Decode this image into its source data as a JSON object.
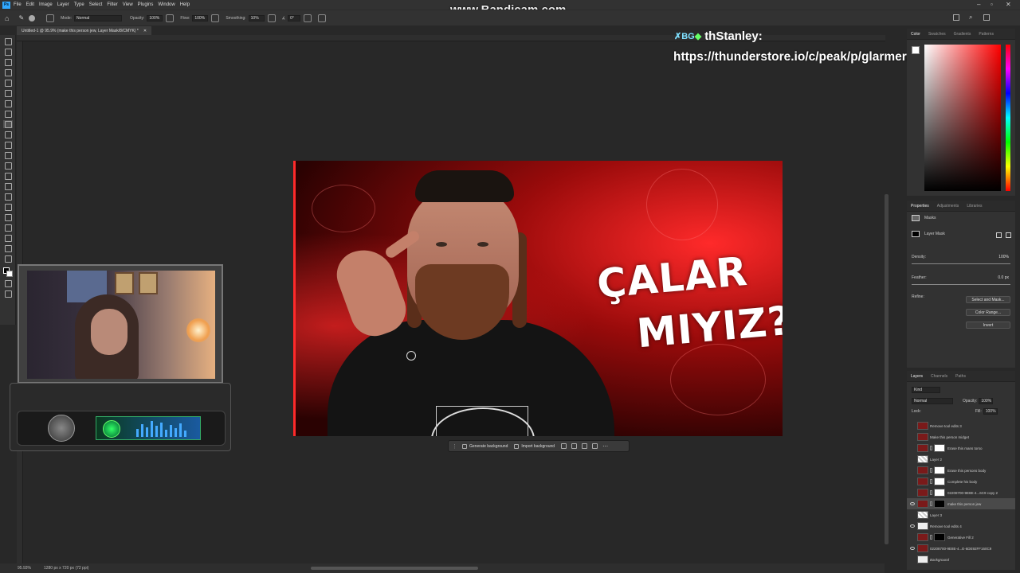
{
  "watermark": "www.Bandicam.com",
  "menu": [
    "File",
    "Edit",
    "Image",
    "Layer",
    "Type",
    "Select",
    "Filter",
    "View",
    "Plugins",
    "Window",
    "Help"
  ],
  "options": {
    "mode_label": "Mode:",
    "mode_value": "Normal",
    "opacity_label": "Opacity:",
    "opacity_value": "100%",
    "flow_label": "Flow:",
    "flow_value": "100%",
    "smoothing_label": "Smoothing:",
    "smoothing_value": "10%",
    "angle_value": "0°"
  },
  "doc_tab": "Untitled-1 @ 95.9% (make this person jew, Layer Mask/8/CMYK) *",
  "thumbnail": {
    "line1": "ÇALAR",
    "line2": "MIYIZ?"
  },
  "context_bar": {
    "generate": "Generate background",
    "import": "Import background"
  },
  "overlay": {
    "badge_a": "✗BG",
    "badge_b": "◆",
    "username": "thStanley:",
    "url": "https://thunderstore.io/c/peak/p/glarmer/PEAK_U"
  },
  "color_panel": {
    "tabs": [
      "Color",
      "Swatches",
      "Gradients",
      "Patterns"
    ]
  },
  "properties": {
    "tabs": [
      "Properties",
      "Adjustments",
      "Libraries"
    ],
    "masks_label": "Masks",
    "layer_mask_label": "Layer Mask",
    "density_label": "Density:",
    "density_value": "100%",
    "feather_label": "Feather:",
    "feather_value": "0.0 px",
    "refine_label": "Refine:",
    "select_mask": "Select and Mask...",
    "color_range": "Color Range...",
    "invert": "Invert"
  },
  "layers": {
    "tabs": [
      "Layers",
      "Channels",
      "Paths"
    ],
    "kind": "Kind",
    "blend": "Normal",
    "opacity_label": "Opacity:",
    "opacity_value": "100%",
    "lock_label": "Lock:",
    "fill_label": "Fill:",
    "fill_value": "100%",
    "rows": [
      {
        "name": "Remove tool edits 3",
        "eye": false,
        "thumb": "red",
        "mask": "none"
      },
      {
        "name": "Make this person midget",
        "eye": false,
        "thumb": "red",
        "mask": "none"
      },
      {
        "name": "Erase this mans torso",
        "eye": false,
        "thumb": "red",
        "mask": "white"
      },
      {
        "name": "Layer 2",
        "eye": false,
        "thumb": "check",
        "mask": "none"
      },
      {
        "name": "Erase this persons body",
        "eye": false,
        "thumb": "red",
        "mask": "white"
      },
      {
        "name": "Complete his body",
        "eye": false,
        "thumb": "red",
        "mask": "white"
      },
      {
        "name": "02208700-9E8E-4...6C9 copy 2",
        "eye": false,
        "thumb": "red",
        "mask": "white"
      },
      {
        "name": "make this person jew",
        "eye": true,
        "thumb": "red",
        "mask": "dark",
        "selected": true
      },
      {
        "name": "Layer 3",
        "eye": false,
        "thumb": "check",
        "mask": "none"
      },
      {
        "name": "Remove tool edits 4",
        "eye": true,
        "thumb": "white",
        "mask": "none"
      },
      {
        "name": "Generative Fill 2",
        "eye": false,
        "thumb": "red",
        "mask": "dark"
      },
      {
        "name": "02208700-9E8E-4...E-6DE92FF160C9",
        "eye": true,
        "thumb": "red",
        "mask": "none"
      },
      {
        "name": "Background",
        "eye": false,
        "thumb": "white",
        "mask": "none"
      }
    ]
  },
  "status": {
    "zoom": "95.93%",
    "size": "1280 px x 720 px (72 ppi)"
  }
}
